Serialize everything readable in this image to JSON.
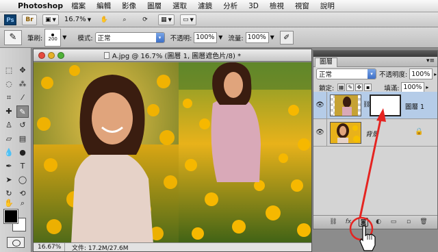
{
  "menubar": {
    "apple": "",
    "app": "Photoshop",
    "items": [
      "檔案",
      "編輯",
      "影像",
      "圖層",
      "選取",
      "濾鏡",
      "分析",
      "3D",
      "檢視",
      "視窗",
      "說明"
    ]
  },
  "appbar": {
    "logo": "Ps",
    "br": "Br",
    "zoom": "16.7%"
  },
  "options": {
    "brush_label": "筆刷:",
    "brush_size": "200",
    "mode_label": "模式:",
    "mode_value": "正常",
    "opacity_label": "不透明:",
    "opacity_value": "100%",
    "flow_label": "流量:",
    "flow_value": "100%"
  },
  "document": {
    "title": "A.jpg @ 16.7% (圖層 1, 圖層遮色片/8) *",
    "status_zoom": "16.67%",
    "status_size": "文件: 17.2M/27.6M"
  },
  "layers_panel": {
    "tab": "圖層",
    "blend_mode": "正常",
    "opacity_label": "不透明度:",
    "opacity_value": "100%",
    "lock_label": "鎖定:",
    "fill_label": "填滿:",
    "fill_value": "100%",
    "layers": [
      {
        "name": "圖層 1",
        "visible": true,
        "has_mask": true,
        "selected": true
      },
      {
        "name": "背景",
        "visible": true,
        "locked": true,
        "selected": false
      }
    ]
  },
  "colors": {
    "selected_row": "#b5cce8",
    "arrow": "#e52421",
    "photo_yellow": "#f2b000"
  },
  "annotation": {
    "target": "add-layer-mask-button",
    "cursor": "hand-pointer-icon"
  }
}
